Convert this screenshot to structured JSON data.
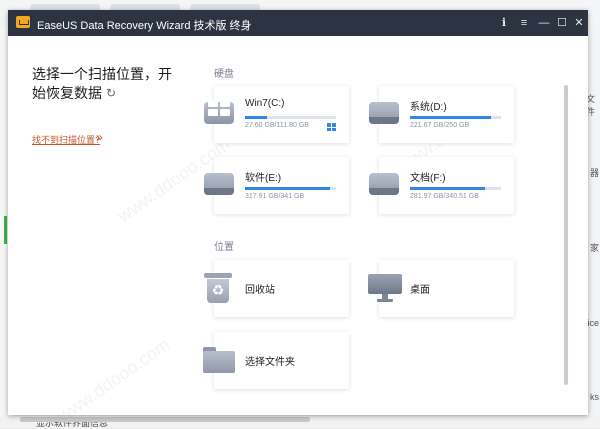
{
  "window": {
    "title": "EaseUS Data Recovery Wizard 技术版 终身",
    "controls": {
      "info": "ℹ",
      "menu": "≡",
      "minimize": "—",
      "maximize": "☐",
      "close": "✕"
    }
  },
  "left": {
    "heading": "选择一个扫描位置，开始恢复数据",
    "link": "找不到扫描位置?",
    "link_arrow": "»"
  },
  "sections": {
    "disks": "硬盘",
    "locations": "位置"
  },
  "drives": [
    {
      "name": "Win7(C:)",
      "size": "27.60 GB/111.80 GB",
      "used_fraction": 0.247,
      "system": true
    },
    {
      "name": "系统(D:)",
      "size": "221.67 GB/250 GB",
      "used_fraction": 0.887
    },
    {
      "name": "软件(E:)",
      "size": "317.91 GB/341 GB",
      "used_fraction": 0.932
    },
    {
      "name": "文档(F:)",
      "size": "281.97 GB/340.51 GB",
      "used_fraction": 0.828
    }
  ],
  "locations": [
    {
      "name": "回收站",
      "icon": "recycle-bin-icon"
    },
    {
      "name": "桌面",
      "icon": "monitor-icon"
    },
    {
      "name": "选择文件夹",
      "icon": "folder-icon"
    }
  ],
  "colors": {
    "titlebar": "#2c3442",
    "accent": "#2f86e6",
    "link": "#c0582b"
  },
  "background": {
    "right_fragments": [
      "文件",
      "器",
      "家",
      "fice",
      "ks"
    ],
    "bottom_text": "显示软件界面信息"
  }
}
